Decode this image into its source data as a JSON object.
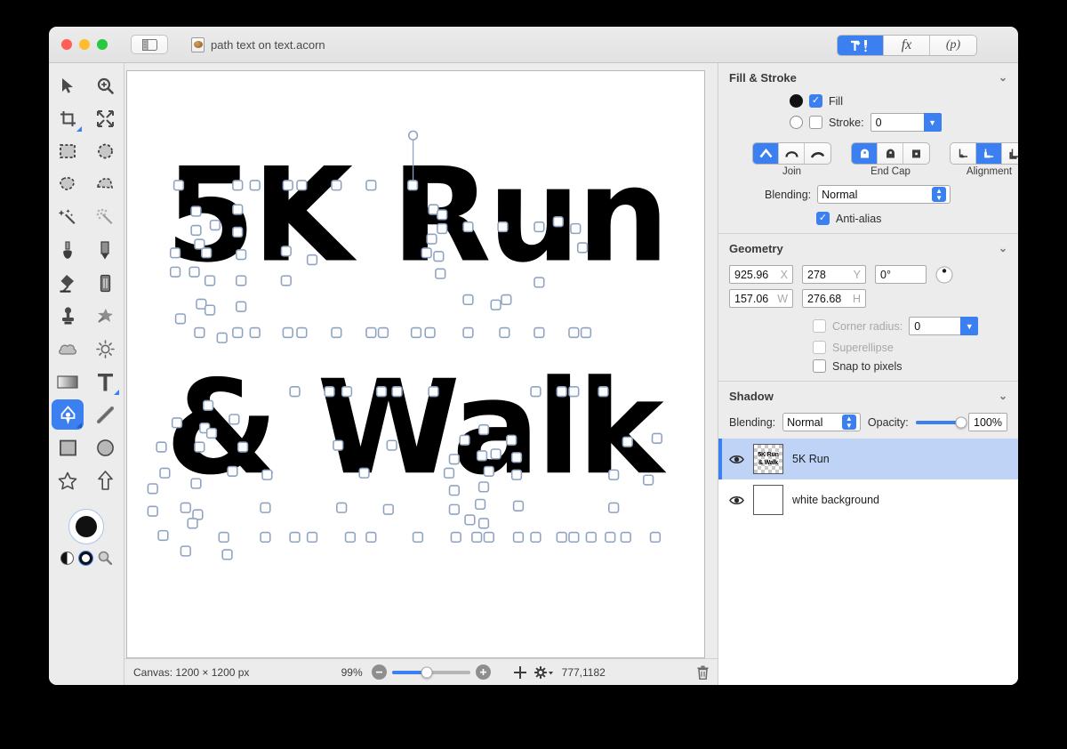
{
  "window": {
    "title": "path text on text.acorn",
    "traffic_lights": [
      "close-button",
      "minimize-button",
      "zoom-button"
    ],
    "sidebar_toggle_icon": "sidebar-toggle-icon",
    "document_icon": "acorn-document-icon"
  },
  "toolbar": {
    "segments": [
      {
        "name": "tools-inspector",
        "label": "",
        "icon": "hammer-pen-icon",
        "active": true
      },
      {
        "name": "filters-inspector",
        "label": "fx",
        "icon": "fx-icon",
        "active": false
      },
      {
        "name": "palette-inspector",
        "label": "(p)",
        "icon": "p-icon",
        "active": false
      }
    ]
  },
  "tools": {
    "items": [
      {
        "name": "move-tool",
        "icon": "arrow-cursor-icon",
        "active": false
      },
      {
        "name": "zoom-tool",
        "icon": "magnifier-plus-icon",
        "active": false
      },
      {
        "name": "crop-tool",
        "icon": "crop-icon",
        "active": false,
        "badge": true
      },
      {
        "name": "transform-tool",
        "icon": "arrows-expand-icon",
        "active": false
      },
      {
        "name": "rect-select-tool",
        "icon": "marquee-rect-icon",
        "active": false
      },
      {
        "name": "ellipse-select-tool",
        "icon": "marquee-ellipse-icon",
        "active": false
      },
      {
        "name": "lasso-tool",
        "icon": "lasso-icon",
        "active": false
      },
      {
        "name": "polygon-lasso-tool",
        "icon": "polygon-lasso-icon",
        "active": false
      },
      {
        "name": "magic-wand-tool",
        "icon": "magic-wand-icon",
        "active": false
      },
      {
        "name": "select-similar-tool",
        "icon": "dotted-wand-icon",
        "active": false
      },
      {
        "name": "eyedropper-tool",
        "icon": "eyedropper-icon",
        "active": false
      },
      {
        "name": "pencil-tool",
        "icon": "pencil-icon",
        "active": false
      },
      {
        "name": "paint-bucket-tool",
        "icon": "paint-bucket-icon",
        "active": false
      },
      {
        "name": "eraser-tool",
        "icon": "eraser-icon",
        "active": false
      },
      {
        "name": "clone-stamp-tool",
        "icon": "clone-stamp-icon",
        "active": false
      },
      {
        "name": "smudge-tool",
        "icon": "smudge-splat-icon",
        "active": false
      },
      {
        "name": "blur-tool",
        "icon": "cloud-blur-icon",
        "active": false
      },
      {
        "name": "dodge-tool",
        "icon": "sun-dodge-icon",
        "active": false
      },
      {
        "name": "gradient-tool",
        "icon": "gradient-icon",
        "active": false
      },
      {
        "name": "text-tool",
        "icon": "text-t-icon",
        "active": false,
        "badge": true
      },
      {
        "name": "pen-tool",
        "icon": "pen-nib-icon",
        "active": true,
        "badge": true
      },
      {
        "name": "line-tool",
        "icon": "line-icon",
        "active": false
      },
      {
        "name": "rectangle-tool",
        "icon": "rectangle-icon",
        "active": false
      },
      {
        "name": "ellipse-tool",
        "icon": "ellipse-icon",
        "active": false
      },
      {
        "name": "star-tool",
        "icon": "star-icon",
        "active": false
      },
      {
        "name": "arrow-tool",
        "icon": "arrow-shape-icon",
        "active": false
      }
    ],
    "color_well": {
      "name": "foreground-color-well",
      "color": "#111111"
    },
    "swatch_controls": [
      {
        "name": "invert-colors-icon"
      },
      {
        "name": "reset-colors-icon"
      },
      {
        "name": "color-picker-magnifier-icon"
      }
    ]
  },
  "canvas": {
    "line1": "5K Run",
    "line2": "& Walk",
    "text_color": "#000000",
    "background": "#ffffff",
    "handle_color": "#ffffff",
    "handle_border": "#8fa3c0"
  },
  "status": {
    "canvas_label": "Canvas: 1200 × 1200 px",
    "zoom_level": "99%",
    "zoom_out_icon": "minus-circle-icon",
    "zoom_in_icon": "plus-circle-icon",
    "add_layer_icon": "plus-icon",
    "layer_actions_icon": "gear-dropdown-icon",
    "coordinates": "777,1182",
    "delete_icon": "trash-icon"
  },
  "inspector": {
    "fill_stroke": {
      "title": "Fill & Stroke",
      "fill_label": "Fill",
      "fill_checked": true,
      "fill_color": "#111111",
      "stroke_label": "Stroke:",
      "stroke_checked": false,
      "stroke_color": "#ffffff",
      "stroke_width": "0",
      "join_label": "Join",
      "join_options": [
        "miter-join-icon",
        "round-join-icon",
        "bevel-join-icon"
      ],
      "join_selected": 0,
      "endcap_label": "End Cap",
      "endcap_options": [
        "butt-cap-icon",
        "round-cap-icon",
        "square-cap-icon"
      ],
      "endcap_selected": 0,
      "alignment_label": "Alignment",
      "alignment_options": [
        "align-inside-icon",
        "align-center-icon",
        "align-outside-icon"
      ],
      "alignment_selected": 1,
      "blending_label": "Blending:",
      "blending_value": "Normal",
      "antialias_label": "Anti-alias",
      "antialias_checked": true
    },
    "geometry": {
      "title": "Geometry",
      "x_value": "925.96",
      "x_label": "X",
      "y_value": "278",
      "y_label": "Y",
      "rotation_value": "0°",
      "rotation_knob_icon": "rotation-knob-icon",
      "w_value": "157.06",
      "w_label": "W",
      "h_value": "276.68",
      "h_label": "H",
      "corner_radius_label": "Corner radius:",
      "corner_radius_value": "0",
      "corner_radius_checked": false,
      "superellipse_label": "Superellipse",
      "superellipse_checked": false,
      "snap_label": "Snap to pixels",
      "snap_checked": false
    },
    "shadow": {
      "title": "Shadow",
      "blending_label": "Blending:",
      "blending_value": "Normal",
      "opacity_label": "Opacity:",
      "opacity_value": "100%",
      "opacity_percent": 100
    },
    "layers": [
      {
        "name": "5K Run",
        "selected": true,
        "visible": true,
        "thumb_line1": "5K Run",
        "thumb_line2": "& Walk",
        "transparent": true
      },
      {
        "name": "white background",
        "selected": false,
        "visible": true,
        "thumb_line1": "",
        "thumb_line2": "",
        "transparent": false
      }
    ]
  }
}
